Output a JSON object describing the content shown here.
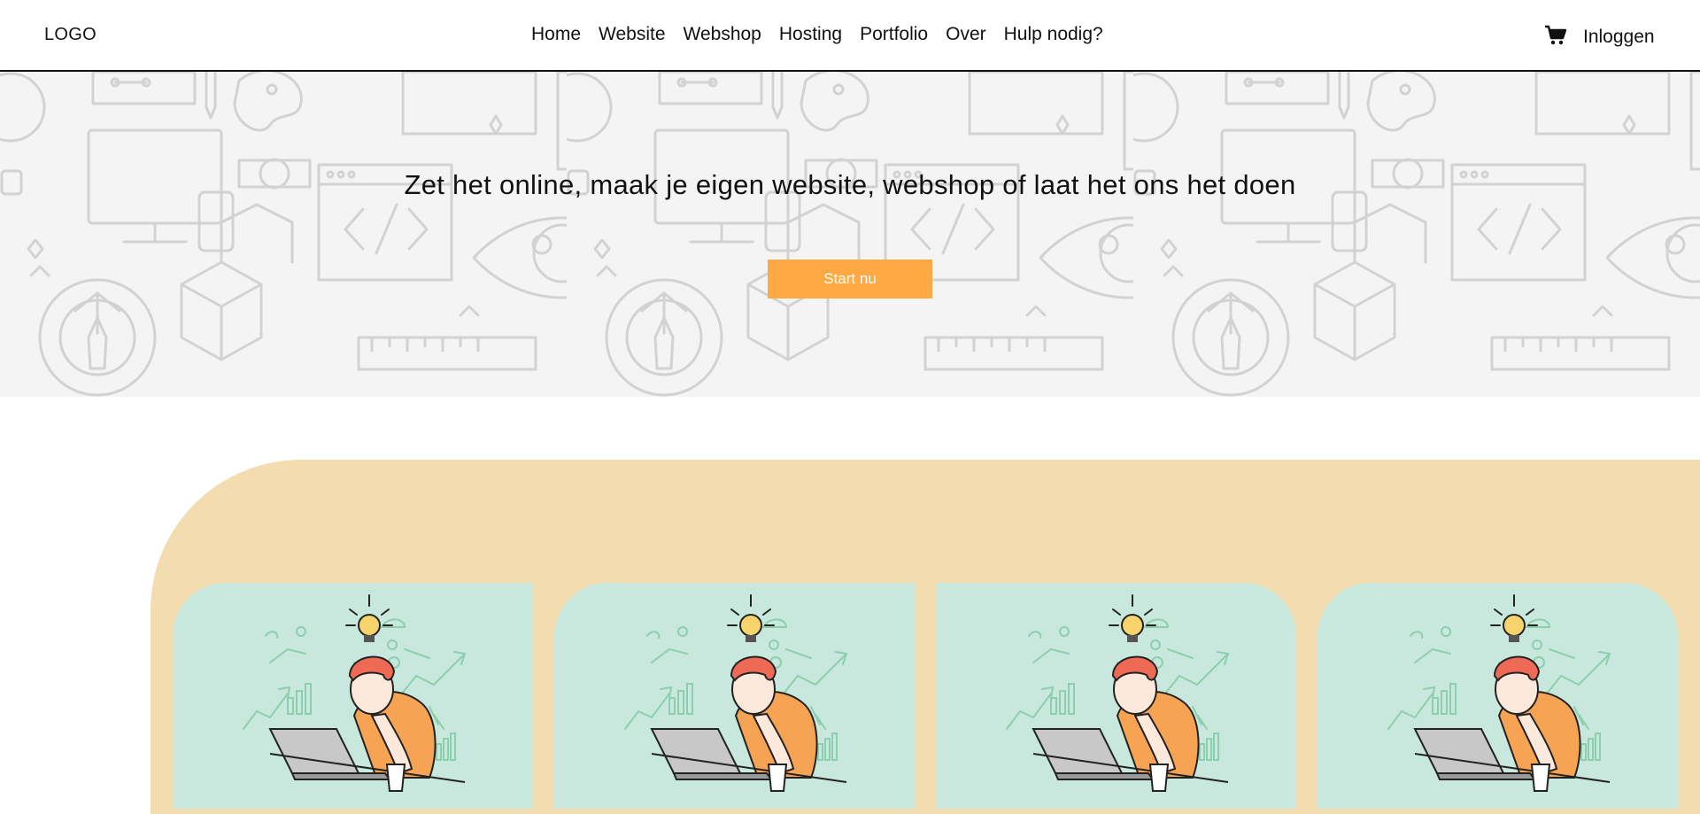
{
  "header": {
    "logo": "LOGO",
    "nav": [
      "Home",
      "Website",
      "Webshop",
      "Hosting",
      "Portfolio",
      "Over",
      "Hulp nodig?"
    ],
    "cart_icon": "shopping-cart-icon",
    "login_label": "Inloggen"
  },
  "hero": {
    "title": "Zet het online, maak je eigen website, webshop of laat het ons het doen",
    "button_label": "Start nu",
    "button_color": "#ffa944",
    "background_pattern": "web-design-line-icons-pattern"
  },
  "features": {
    "section_color": "#f2dcb0",
    "card_color": "#c9e8dd",
    "cards": [
      {
        "illustration": "thinking-person-laptop-illustration"
      },
      {
        "illustration": "thinking-person-laptop-illustration"
      },
      {
        "illustration": "thinking-person-laptop-illustration"
      },
      {
        "illustration": "thinking-person-laptop-illustration"
      }
    ]
  }
}
